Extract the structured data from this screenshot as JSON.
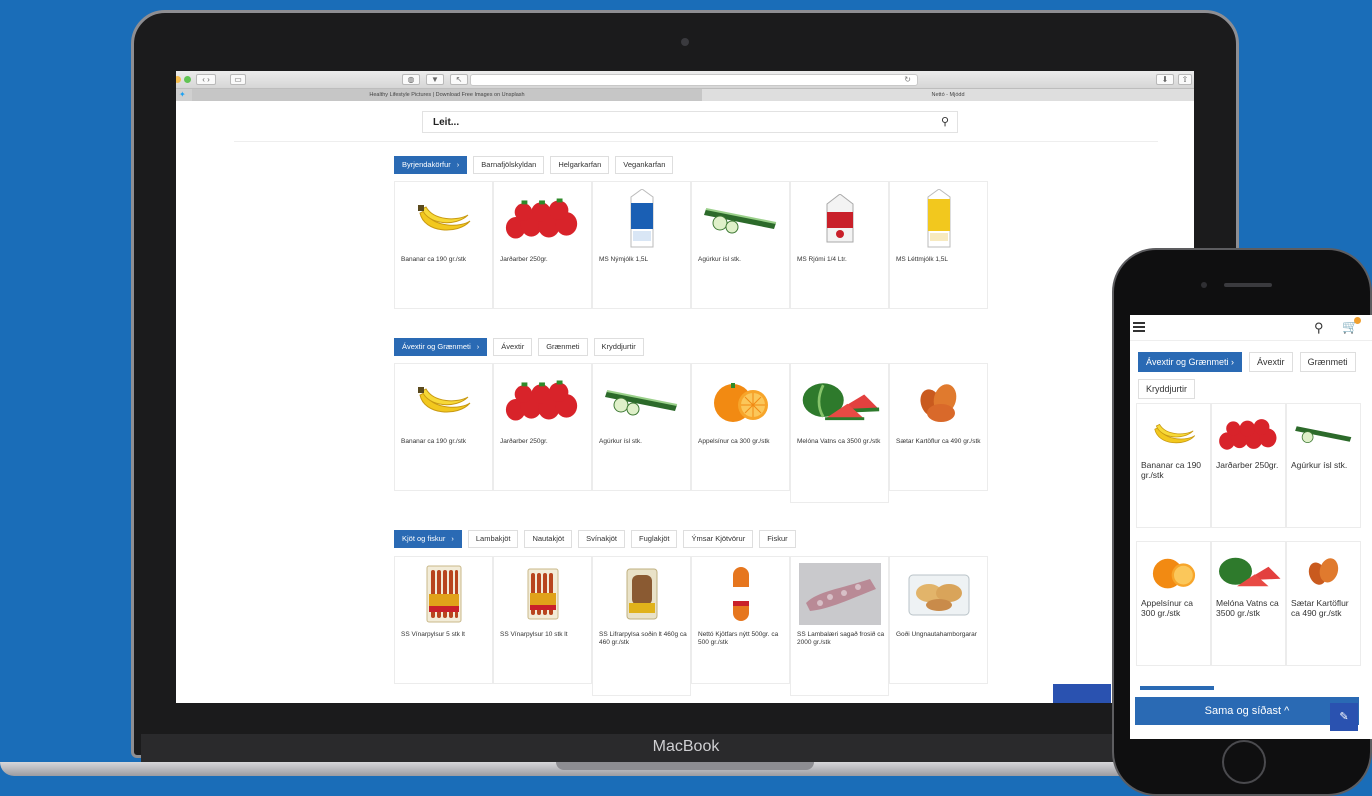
{
  "laptop": {
    "brand": "MacBook"
  },
  "browser": {
    "tabs": [
      "Healthy Lifestyle Pictures | Download Free Images on Unsplash",
      "Nettó - Mjódd"
    ]
  },
  "search": {
    "placeholder": "Leit..."
  },
  "sections": [
    {
      "tabs": [
        "Byrjendakörfur",
        "Barnafjölskyldan",
        "Helgarkarfan",
        "Vegankarfan"
      ],
      "active": 0,
      "products": [
        {
          "name": "Bananar ca 190 gr./stk",
          "icon": "banana"
        },
        {
          "name": "Jarðarber 250gr.",
          "icon": "strawberry"
        },
        {
          "name": "MS Nýmjólk 1,5L",
          "icon": "milk-carton-blue"
        },
        {
          "name": "Agúrkur ísl stk.",
          "icon": "cucumber"
        },
        {
          "name": "MS Rjómi 1/4 Ltr.",
          "icon": "cream-carton"
        },
        {
          "name": "MS Léttmjólk 1,5L",
          "icon": "milk-carton-yellow"
        }
      ]
    },
    {
      "tabs": [
        "Ávextir og Grænmeti",
        "Ávextir",
        "Grænmeti",
        "Kryddjurtir"
      ],
      "active": 0,
      "products": [
        {
          "name": "Bananar ca 190 gr./stk",
          "icon": "banana"
        },
        {
          "name": "Jarðarber 250gr.",
          "icon": "strawberry"
        },
        {
          "name": "Agúrkur ísl stk.",
          "icon": "cucumber"
        },
        {
          "name": "Appelsínur ca 300 gr./stk",
          "icon": "orange"
        },
        {
          "name": "Melóna Vatns ca 3500 gr./stk",
          "icon": "watermelon"
        },
        {
          "name": "Sætar Kartöflur ca 490 gr./stk",
          "icon": "sweet-potato"
        }
      ]
    },
    {
      "tabs": [
        "Kjöt og fiskur",
        "Lambakjöt",
        "Nautakjöt",
        "Svínakjöt",
        "Fuglakjöt",
        "Ýmsar Kjötvörur",
        "Fiskur"
      ],
      "active": 0,
      "products": [
        {
          "name": "SS Vínarpylsur 5 stk lt",
          "icon": "sausage-pack"
        },
        {
          "name": "SS Vínarpylsur 10 stk lt",
          "icon": "sausage-pack"
        },
        {
          "name": "SS Lifrarpylsa soðin lt 460g ca 460 gr./stk",
          "icon": "liver-sausage"
        },
        {
          "name": "Nettó Kjötfars nýtt 500gr. ca 500 gr./stk",
          "icon": "meat-roll"
        },
        {
          "name": "SS Lambalæri sagað frosið ca 2000 gr./stk",
          "icon": "frozen-lamb"
        },
        {
          "name": "Goði Ungnautahamborgarar",
          "icon": "burger-pack"
        }
      ]
    }
  ],
  "phone": {
    "chips": [
      "Ávextir og Grænmeti",
      "Ávextir",
      "Grænmeti",
      "Kryddjurtir"
    ],
    "products": [
      {
        "name": "Bananar ca 190 gr./stk",
        "icon": "banana"
      },
      {
        "name": "Jarðarber 250gr.",
        "icon": "strawberry"
      },
      {
        "name": "Agúrkur ísl stk.",
        "icon": "cucumber"
      },
      {
        "name": "Appelsínur ca 300 gr./stk",
        "icon": "orange"
      },
      {
        "name": "Melóna Vatns ca 3500 gr./stk",
        "icon": "watermelon"
      },
      {
        "name": "Sætar Kartöflur ca 490 gr./stk",
        "icon": "sweet-potato"
      }
    ],
    "bottom_button": "Sama og síðast ^"
  },
  "colors": {
    "background": "#1a6db8",
    "accent": "#2a6ab4"
  }
}
